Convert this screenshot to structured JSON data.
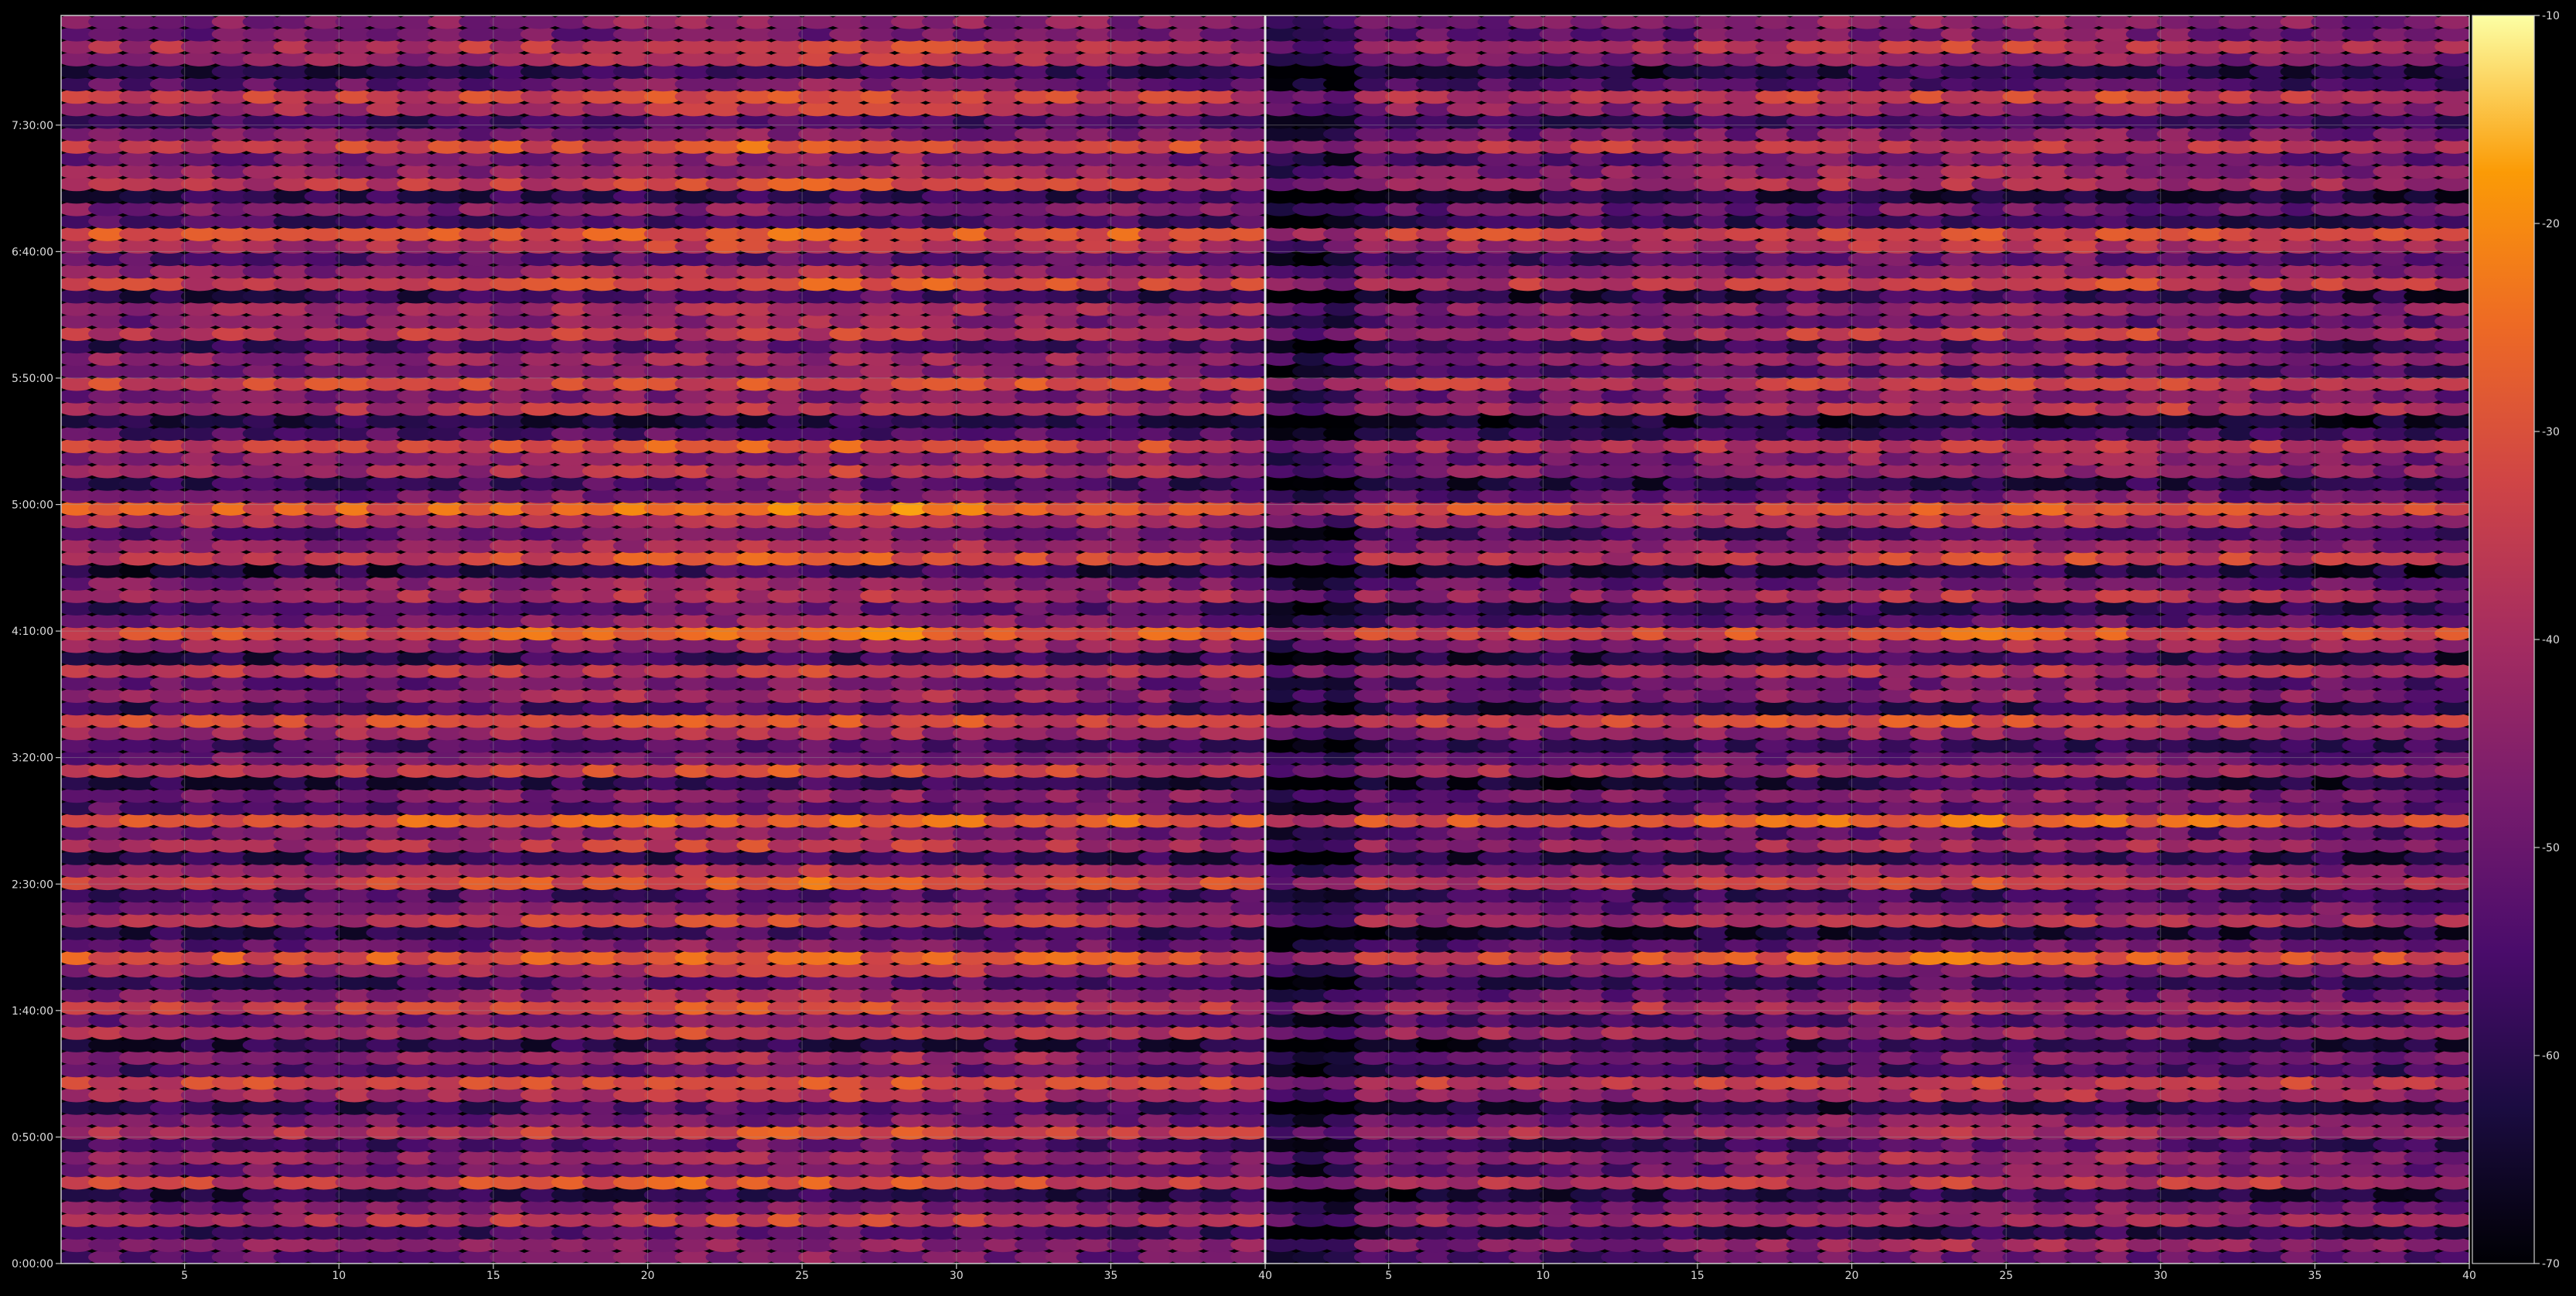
{
  "chart_data": {
    "type": "heatmap",
    "title": "",
    "panels": [
      {
        "name": "",
        "x_range": [
          1,
          40
        ]
      },
      {
        "name": "",
        "x_range": [
          40,
          79
        ]
      }
    ],
    "x_tick_labels": [
      "5",
      "10",
      "15",
      "20",
      "25",
      "30",
      "35",
      "40"
    ],
    "x_tick_values": [
      5,
      10,
      15,
      20,
      25,
      30,
      35,
      40
    ],
    "y_tick_labels": [
      "0:00:00",
      "0:50:00",
      "1:40:00",
      "2:30:00",
      "3:20:00",
      "4:10:00",
      "5:00:00",
      "5:50:00",
      "6:40:00",
      "7:30:00"
    ],
    "y_tick_seconds": [
      0,
      3000,
      6000,
      9000,
      12000,
      15000,
      18000,
      21000,
      24000,
      27000
    ],
    "y_range_seconds": [
      0,
      29600
    ],
    "colorbar": {
      "colormap": "inferno",
      "range": [
        -70,
        -10
      ],
      "tick_labels": [
        "-70",
        "-60",
        "-50",
        "-40",
        "-30",
        "-20",
        "-10"
      ],
      "tick_values": [
        -70,
        -60,
        -50,
        -40,
        -30,
        -20,
        -10
      ]
    },
    "grid": true,
    "colors": {
      "background": "#000000",
      "grid": "#9a9a9a",
      "axis": "#cccccc",
      "text": "#dddddd"
    },
    "row_levels": [
      -52,
      -45,
      -58,
      -40,
      -48,
      -62,
      -35,
      -50,
      -44,
      -57,
      -38,
      -49,
      -60,
      -42,
      -33,
      -55,
      -46,
      -62,
      -40,
      -51,
      -36,
      -47,
      -58,
      -43,
      -30,
      -52,
      -61,
      -39,
      -48,
      -56,
      -34,
      -45,
      -60,
      -41,
      -50,
      -28,
      -54,
      -47,
      -62,
      -38,
      -49,
      -56,
      -42,
      -33,
      -58,
      -46,
      -52,
      -37,
      -60,
      -44,
      -31,
      -50,
      -57,
      -41,
      -48,
      -63,
      -36,
      -45,
      -53,
      -40,
      -29,
      -51,
      -59,
      -43,
      -47,
      -35,
      -55,
      -62,
      -39,
      -48,
      -33,
      -52,
      -44,
      -58,
      -37,
      -49,
      -42,
      -61,
      -35,
      -46,
      -54,
      -40,
      -30,
      -56,
      -47,
      -60,
      -38,
      -45,
      -51,
      -34,
      -48,
      -57,
      -42,
      -36,
      -53,
      -62,
      -44,
      -39,
      -50,
      -46
    ]
  }
}
